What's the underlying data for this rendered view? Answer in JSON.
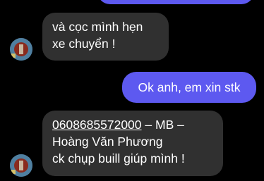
{
  "colors": {
    "background": "#000000",
    "incoming_bubble": "#303030",
    "outgoing_bubble": "#5d59f0",
    "text": "#ffffff"
  },
  "messages": [
    {
      "direction": "incoming",
      "lines": [
        "và cọc mình hẹn",
        "xe chuyển !"
      ]
    },
    {
      "direction": "outgoing",
      "lines": [
        "Ok anh, em xin stk"
      ]
    },
    {
      "direction": "incoming",
      "phone": "0608685572000",
      "lines": [
        "– MB –",
        "Hoàng Văn Phương",
        "ck chụp buill giúp mình !"
      ]
    }
  ],
  "avatar_icon": "user-avatar-photo"
}
